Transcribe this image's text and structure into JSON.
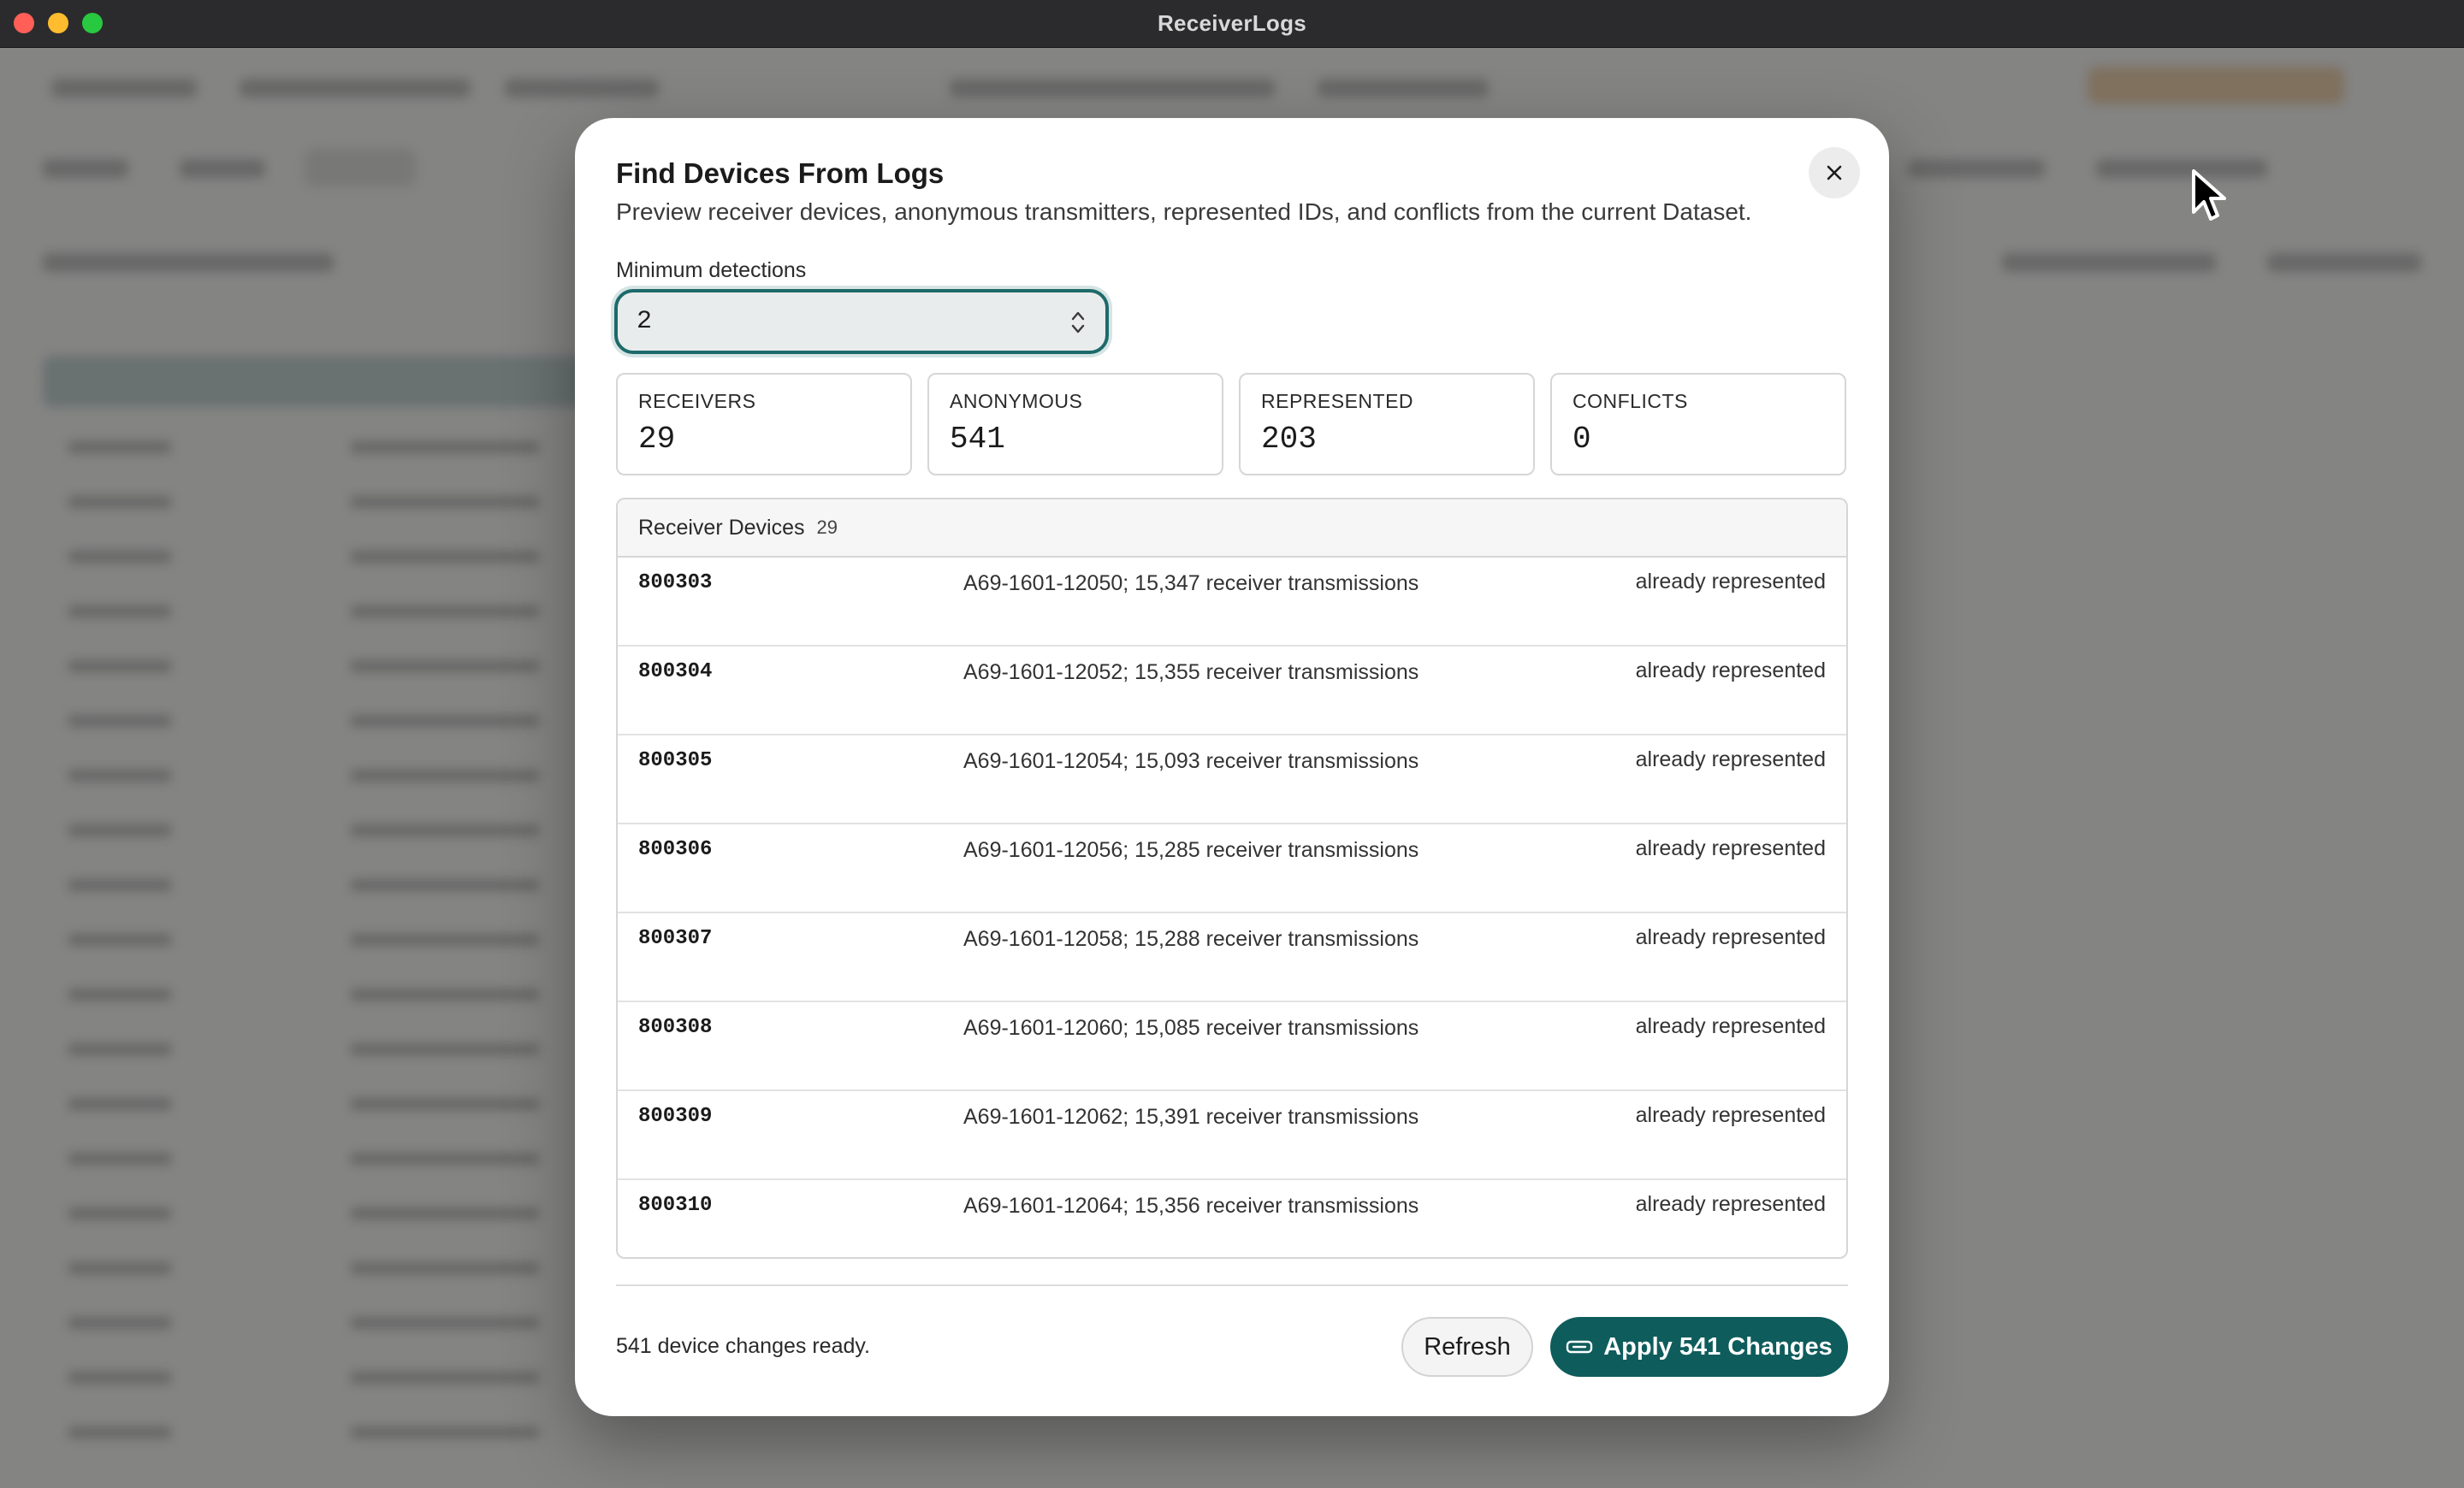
{
  "window": {
    "title": "ReceiverLogs"
  },
  "modal": {
    "title": "Find Devices From Logs",
    "description": "Preview receiver devices, anonymous transmitters, represented IDs, and conflicts from the current Dataset.",
    "min_detections_label": "Minimum detections",
    "min_detections_value": "2",
    "close_icon": "close-icon"
  },
  "stats": [
    {
      "label": "RECEIVERS",
      "value": "29"
    },
    {
      "label": "ANONYMOUS",
      "value": "541"
    },
    {
      "label": "REPRESENTED",
      "value": "203"
    },
    {
      "label": "CONFLICTS",
      "value": "0"
    }
  ],
  "receiver_devices": {
    "title": "Receiver Devices",
    "count": "29",
    "rows": [
      {
        "id": "800303",
        "desc": "A69-1601-12050; 15,347 receiver transmissions",
        "status": "already represented"
      },
      {
        "id": "800304",
        "desc": "A69-1601-12052; 15,355 receiver transmissions",
        "status": "already represented"
      },
      {
        "id": "800305",
        "desc": "A69-1601-12054; 15,093 receiver transmissions",
        "status": "already represented"
      },
      {
        "id": "800306",
        "desc": "A69-1601-12056; 15,285 receiver transmissions",
        "status": "already represented"
      },
      {
        "id": "800307",
        "desc": "A69-1601-12058; 15,288 receiver transmissions",
        "status": "already represented"
      },
      {
        "id": "800308",
        "desc": "A69-1601-12060; 15,085 receiver transmissions",
        "status": "already represented"
      },
      {
        "id": "800309",
        "desc": "A69-1601-12062; 15,391 receiver transmissions",
        "status": "already represented"
      },
      {
        "id": "800310",
        "desc": "A69-1601-12064; 15,356 receiver transmissions",
        "status": "already represented"
      }
    ]
  },
  "footer": {
    "status": "541 device changes ready.",
    "refresh_label": "Refresh",
    "apply_label": "Apply 541 Changes",
    "apply_icon": "link-icon"
  },
  "colors": {
    "accent": "#0f5c5c",
    "focus_ring": "#1d6a6a"
  }
}
